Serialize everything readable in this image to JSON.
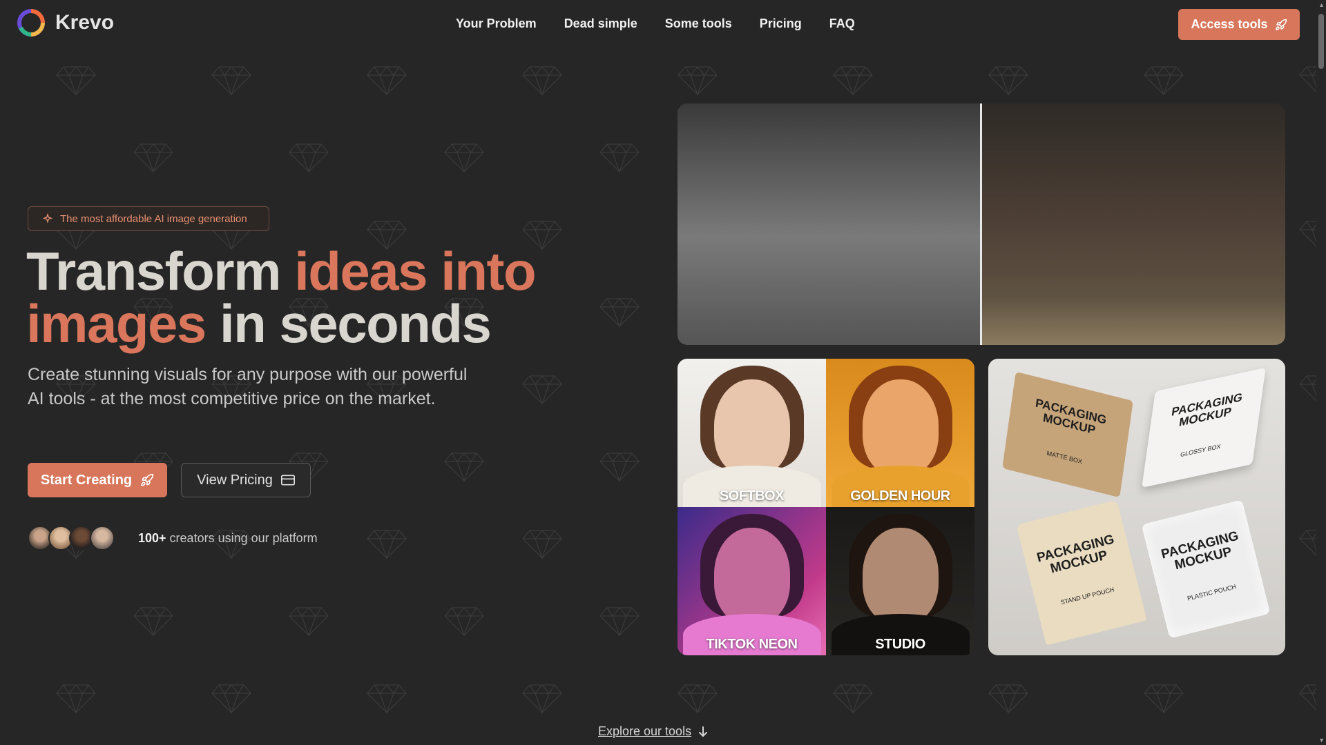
{
  "brand": {
    "name": "Krevo"
  },
  "nav": {
    "items": [
      "Your Problem",
      "Dead simple",
      "Some tools",
      "Pricing",
      "FAQ"
    ],
    "cta_label": "Access tools"
  },
  "hero": {
    "badge": "The most affordable AI image generation",
    "headline_part1": "Transform ",
    "headline_accent1": "ideas into",
    "headline_accent2": "images",
    "headline_part2": " in seconds",
    "subtext": "Create stunning visuals for any purpose with our powerful AI tools - at the most competitive price on the market.",
    "primary_button": "Start Creating",
    "secondary_button": "View Pricing",
    "creators_count": "100+",
    "creators_text": " creators using our platform"
  },
  "showcase": {
    "tiles": [
      "SOFTBOX",
      "GOLDEN HOUR",
      "TIKTOK NEON",
      "STUDIO"
    ],
    "mockups": [
      {
        "title": "PACKAGING MOCKUP",
        "sub": "MATTE BOX"
      },
      {
        "title": "PACKAGING MOCKUP",
        "sub": "GLOSSY BOX"
      },
      {
        "title": "PACKAGING MOCKUP",
        "sub": "STAND UP POUCH"
      },
      {
        "title": "PACKAGING MOCKUP",
        "sub": "PLASTIC POUCH"
      }
    ]
  },
  "footer": {
    "explore_label": "Explore our tools"
  },
  "colors": {
    "accent": "#d7765a",
    "background": "#262626"
  }
}
